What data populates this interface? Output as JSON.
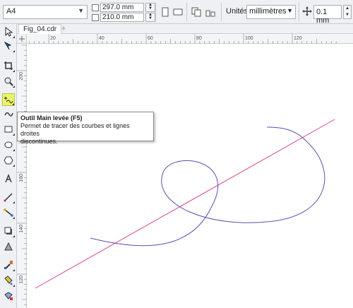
{
  "propbar": {
    "page_size": "A4",
    "width": "297.0 mm",
    "height": "210.0 mm",
    "units_label": "Unités:",
    "units_value": "millimètres",
    "nudge_value": "0.1 mm"
  },
  "tabs": [
    {
      "label": "Fig_04.cdr"
    }
  ],
  "rulers": {
    "horizontal_ticks": [
      "20",
      "40",
      "60",
      "80",
      "100",
      "120"
    ],
    "vertical_ticks": [
      "200",
      "180",
      "160",
      "140",
      "120"
    ]
  },
  "tooltip": {
    "title": "Outil Main levée (F5)",
    "line1": "Permet de tracer des courbes et lignes droites",
    "line2": "discontinues."
  },
  "colors": {
    "accent_active_tool": "#e8f46a",
    "straight_line": "#d9428c",
    "curve": "#5a4fb0"
  }
}
